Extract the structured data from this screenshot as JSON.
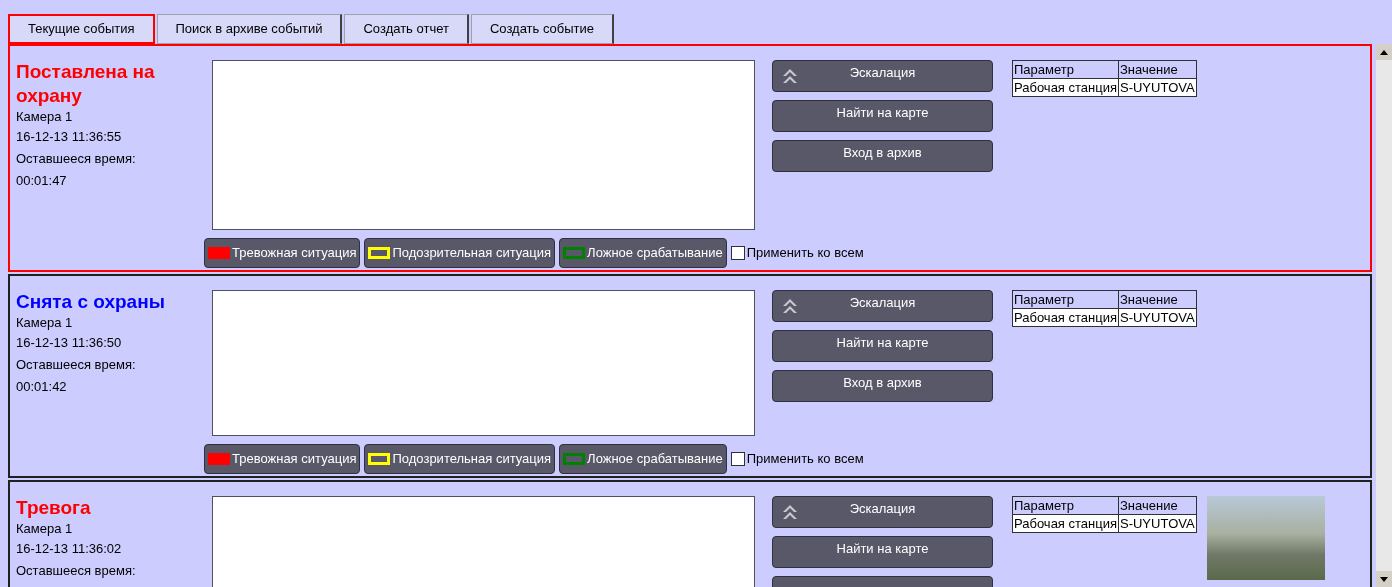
{
  "tabs": [
    {
      "label": "Текущие события",
      "selected": true
    },
    {
      "label": "Поиск в архиве событий",
      "selected": false
    },
    {
      "label": "Создать отчет",
      "selected": false
    },
    {
      "label": "Создать событие",
      "selected": false
    }
  ],
  "events": [
    {
      "title": "Поставлена на охрану",
      "color": "#ff0000",
      "selected": true,
      "camera": "Камера 1",
      "datetime": "16-12-13 11:36:55",
      "remaining_label": "Оставшееся время:",
      "remaining": "00:01:47",
      "actions": [
        "Эскалация",
        "Найти на карте",
        "Вход в архив"
      ],
      "params": {
        "columns": [
          "Параметр",
          "Значение"
        ],
        "rows": [
          [
            "Рабочая станция",
            "S-UYUTOVA"
          ]
        ]
      },
      "photo": false,
      "tags": [
        {
          "label": "Тревожная ситуация",
          "color": "#ff0000",
          "kind": "filled"
        },
        {
          "label": "Подозрительная ситуация",
          "color": "#ffff00",
          "kind": "outline"
        },
        {
          "label": "Ложное срабатывание",
          "color": "#008000",
          "kind": "outline"
        }
      ],
      "apply_all": {
        "label": "Применить ко всем",
        "checked": false
      }
    },
    {
      "title": "Снята с охраны",
      "color": "#0000ff",
      "selected": false,
      "camera": "Камера 1",
      "datetime": "16-12-13 11:36:50",
      "remaining_label": "Оставшееся время:",
      "remaining": "00:01:42",
      "actions": [
        "Эскалация",
        "Найти на карте",
        "Вход в архив"
      ],
      "params": {
        "columns": [
          "Параметр",
          "Значение"
        ],
        "rows": [
          [
            "Рабочая станция",
            "S-UYUTOVA"
          ]
        ]
      },
      "photo": false,
      "tags": [
        {
          "label": "Тревожная ситуация",
          "color": "#ff0000",
          "kind": "filled"
        },
        {
          "label": "Подозрительная ситуация",
          "color": "#ffff00",
          "kind": "outline"
        },
        {
          "label": "Ложное срабатывание",
          "color": "#008000",
          "kind": "outline"
        }
      ],
      "apply_all": {
        "label": "Применить ко всем",
        "checked": false
      }
    },
    {
      "title": "Тревога",
      "color": "#ff0000",
      "selected": false,
      "camera": "Камера 1",
      "datetime": "16-12-13 11:36:02",
      "remaining_label": "Оставшееся время:",
      "actions": [
        "Эскалация",
        "Найти на карте"
      ],
      "params": {
        "columns": [
          "Параметр",
          "Значение"
        ],
        "rows": [
          [
            "Рабочая станция",
            "S-UYUTOVA"
          ]
        ]
      },
      "photo": true
    }
  ]
}
